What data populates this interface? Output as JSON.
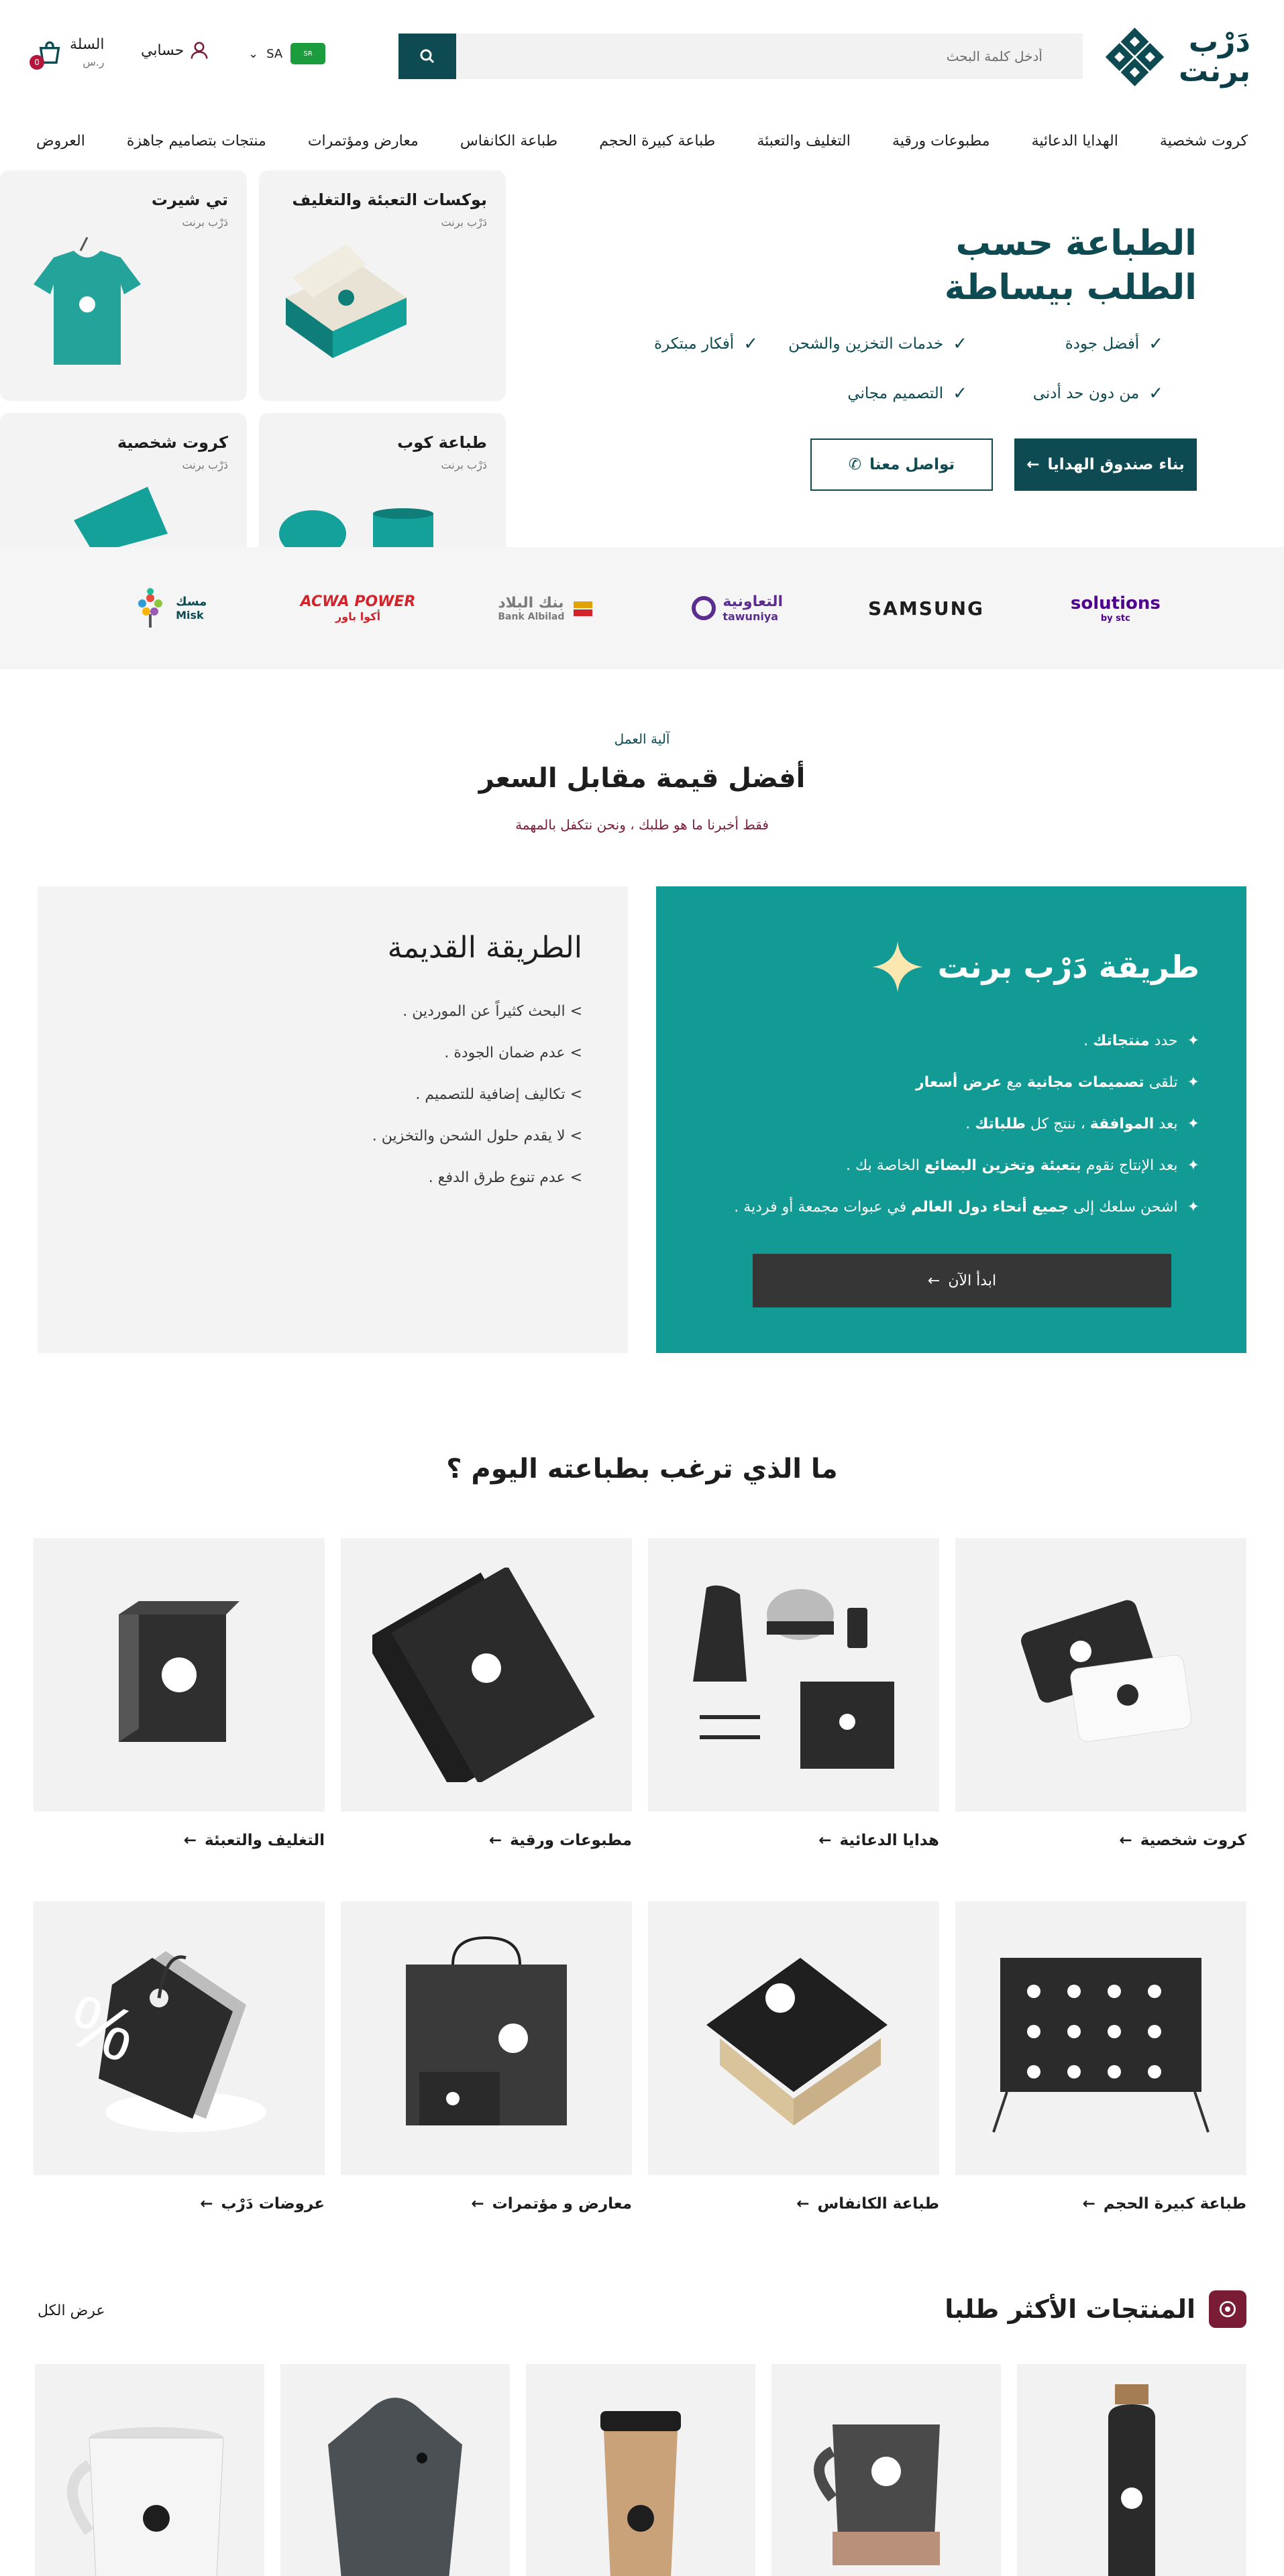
{
  "header": {
    "logo_text_line1": "دَرْب",
    "logo_text_line2": "برنت",
    "search_placeholder": "أدخل كلمة البحث",
    "region_code": "SA",
    "currency_flag": "SR",
    "account_label": "حسابي",
    "cart_label": "السلة",
    "cart_currency": "ر.س",
    "cart_count": "0"
  },
  "nav": [
    "كروت شخصية",
    "الهدايا الدعائية",
    "مطبوعات ورقية",
    "التغليف والتعبئة",
    "طباعة كبيرة الحجم",
    "طباعة الكانفاس",
    "معارض ومؤتمرات",
    "منتجات بتصاميم جاهزة",
    "العروض"
  ],
  "hero": {
    "title": "الطباعة حسب الطلب بيساطة",
    "features": [
      "أفضل جودة",
      "خدمات التخزين والشحن",
      "أفكار مبتكرة",
      "من دون حد أدنى",
      "التصميم مجاني"
    ],
    "primary_button": "بناء صندوق الهدايا",
    "secondary_button": "تواصل معنا",
    "tiles": [
      {
        "title": "بوكسات التعبئة والتغليف",
        "sub": "دَرْب برنت"
      },
      {
        "title": "تي شيرت",
        "sub": "دَرْب برنت"
      },
      {
        "title": "طباعة كوب",
        "sub": "دَرْب برنت"
      },
      {
        "title": "كروت شخصية",
        "sub": "دَرْب برنت"
      }
    ]
  },
  "partners": [
    {
      "name": "solutions",
      "sub": "by stc",
      "color": "#4f008c"
    },
    {
      "name": "SAMSUNG",
      "sub": "",
      "color": "#1d1d1d"
    },
    {
      "name": "التعاونية",
      "sub": "tawuniya",
      "color": "#5b2d8e"
    },
    {
      "name": "بنك البلاد",
      "sub": "Bank Albilad",
      "color": "#7a7a7a"
    },
    {
      "name": "ACWA POWER",
      "sub": "أكوا باور",
      "color": "#d3232b"
    },
    {
      "name": "Misk",
      "sub": "مسك",
      "color": "#0d4a52"
    }
  ],
  "how": {
    "eyebrow": "آلية العمل",
    "title": "أفضل قيمة مقابل السعر",
    "subtitle": "فقط أخبرنا ما هو طلبك ، ونحن نتكفل بالمهمة",
    "new_way_title": "طريقة دَرْب برنت",
    "new_steps": [
      {
        "pre": "حدد",
        "bold": "منتجاتك",
        "post": "."
      },
      {
        "pre": "تلقى",
        "bold": "تصميمات مجانية",
        "mid": "مع",
        "bold2": "عرض أسعار",
        "post": ""
      },
      {
        "pre": "بعد",
        "bold": "الموافقة",
        "mid": "، ننتج كل",
        "bold2": "طلباتك",
        "post": "."
      },
      {
        "pre": "بعد الإنتاج نقوم",
        "bold": "بتعبئة وتخزين البضائع",
        "post": "الخاصة بك ."
      },
      {
        "pre": "اشحن سلعك إلى",
        "bold": "جميع أنحاء دول العالم",
        "post": "في عبوات مجمعة أو فردية ."
      }
    ],
    "start_button": "ابدأ الآن",
    "old_way_title": "الطريقة القديمة",
    "old_steps": [
      "> البحث كثيراً عن الموردين .",
      "> عدم ضمان الجودة .",
      "> تكاليف إضافية للتصميم .",
      "> لا يقدم حلول الشحن والتخزين .",
      "> عدم تنوع طرق الدفع ."
    ]
  },
  "categories": {
    "title": "ما الذي ترغب بطباعته اليوم ؟",
    "items": [
      "كروت شخصية",
      "هدايا الدعائية",
      "مطبوعات ورقية",
      "التغليف والتعبئة",
      "طباعة كبيرة الحجم",
      "طباعة الكانفاس",
      "معارض و مؤتمرات",
      "عروضات دَرْب"
    ]
  },
  "best_sellers": {
    "title": "المنتجات الأكثر طلبا",
    "view_all": "عرض الكل"
  },
  "colors": {
    "brand": "#0d4a52",
    "teal": "#129a94",
    "accent": "#7b1c36"
  }
}
